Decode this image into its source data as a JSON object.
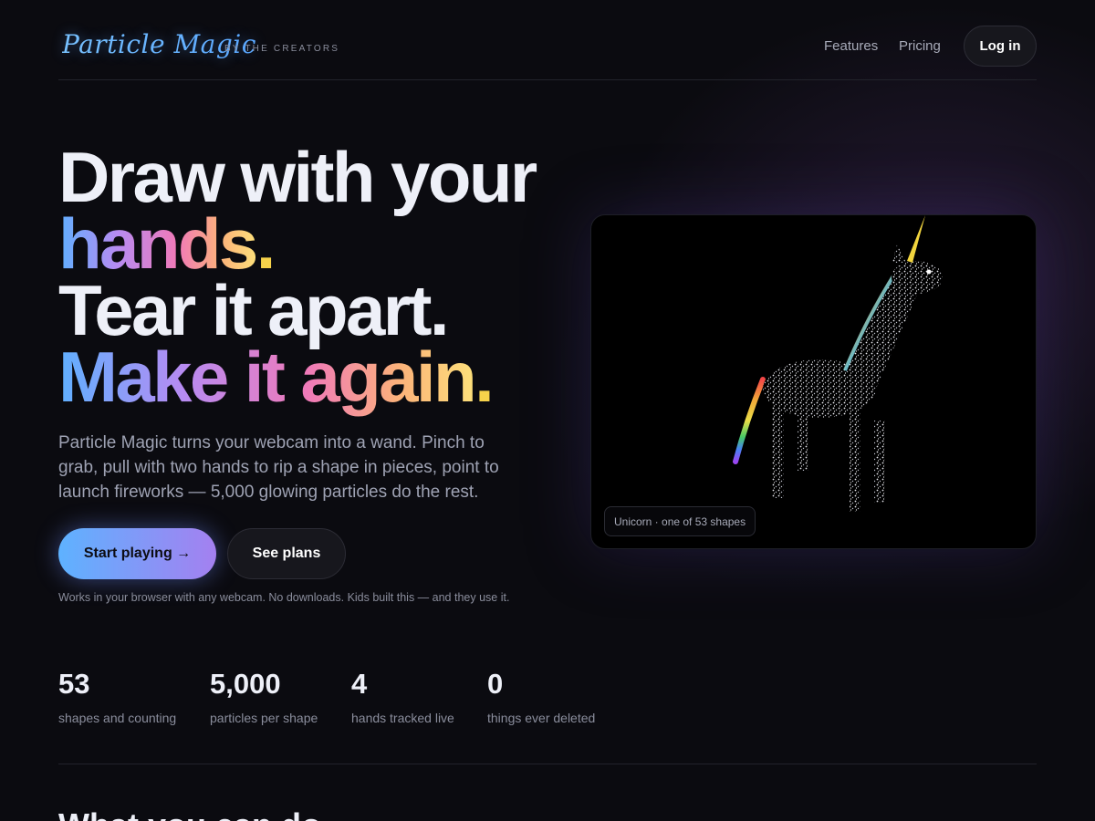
{
  "header": {
    "logo": "Particle Magic",
    "logo_sub": "BY THE CREATORS",
    "nav": {
      "features": "Features",
      "pricing": "Pricing",
      "login": "Log in"
    }
  },
  "hero": {
    "line1": "Draw with your",
    "line2_word": "hands",
    "line3": "Tear it apart.",
    "line4_a": "Make",
    "line4_b": "it",
    "line4_c": "again",
    "period": ".",
    "description": "Particle Magic turns your webcam into a wand. Pinch to grab, pull with two hands to rip a shape in pieces, point to launch fireworks — 5,000 glowing particles do the rest.",
    "cta_primary": "Start playing →",
    "cta_secondary": "See plans",
    "note": "Works in your browser with any webcam. No downloads. Kids built this — and they use it."
  },
  "preview": {
    "caption": "Unicorn · one of 53 shapes"
  },
  "stats": [
    {
      "value": "53",
      "label": "shapes and counting"
    },
    {
      "value": "5,000",
      "label": "particles per shape"
    },
    {
      "value": "4",
      "label": "hands tracked live"
    },
    {
      "value": "0",
      "label": "things ever deleted"
    }
  ],
  "next_section": {
    "heading": "What you can do"
  },
  "colors": {
    "background": "#0b0b10",
    "accent_blue": "#5eb2ff",
    "accent_purple": "#a480f0",
    "accent_pink": "#f07ab8",
    "accent_yellow": "#f7d34b"
  }
}
